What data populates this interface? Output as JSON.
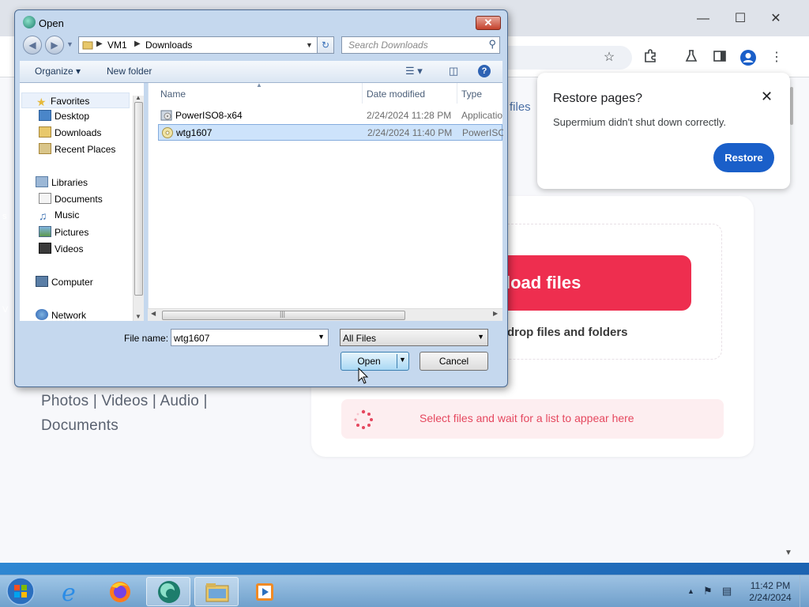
{
  "browser": {
    "restore_popup": {
      "title": "Restore pages?",
      "message": "Supermium didn't shut down correctly.",
      "button": "Restore"
    },
    "page": {
      "files_fragment": "files",
      "upload_button": "Upload files",
      "upload_button_visible": "load files",
      "drop_text": "drop files and folders",
      "status_text": "Select files and wait for a list to appear here",
      "links": [
        "Photos",
        "Videos",
        "Audio",
        "Documents"
      ]
    }
  },
  "dialog": {
    "title": "Open",
    "breadcrumb": [
      "VM1",
      "Downloads"
    ],
    "search_placeholder": "Search Downloads",
    "toolbar": {
      "organize": "Organize",
      "new_folder": "New folder"
    },
    "nav": {
      "favorites": "Favorites",
      "desktop": "Desktop",
      "downloads": "Downloads",
      "recent": "Recent Places",
      "libraries": "Libraries",
      "documents": "Documents",
      "music": "Music",
      "pictures": "Pictures",
      "videos": "Videos",
      "computer": "Computer",
      "network": "Network"
    },
    "columns": {
      "name": "Name",
      "date": "Date modified",
      "type": "Type"
    },
    "files": [
      {
        "name": "PowerISO8-x64",
        "date": "2/24/2024 11:28 PM",
        "type": "Application"
      },
      {
        "name": "wtg1607",
        "date": "2/24/2024 11:40 PM",
        "type": "PowerISO"
      }
    ],
    "file_name_label": "File name:",
    "file_name_value": "wtg1607",
    "file_type": "All Files",
    "open_button": "Open",
    "cancel_button": "Cancel"
  },
  "taskbar": {
    "time": "11:42 PM",
    "date": "2/24/2024"
  }
}
